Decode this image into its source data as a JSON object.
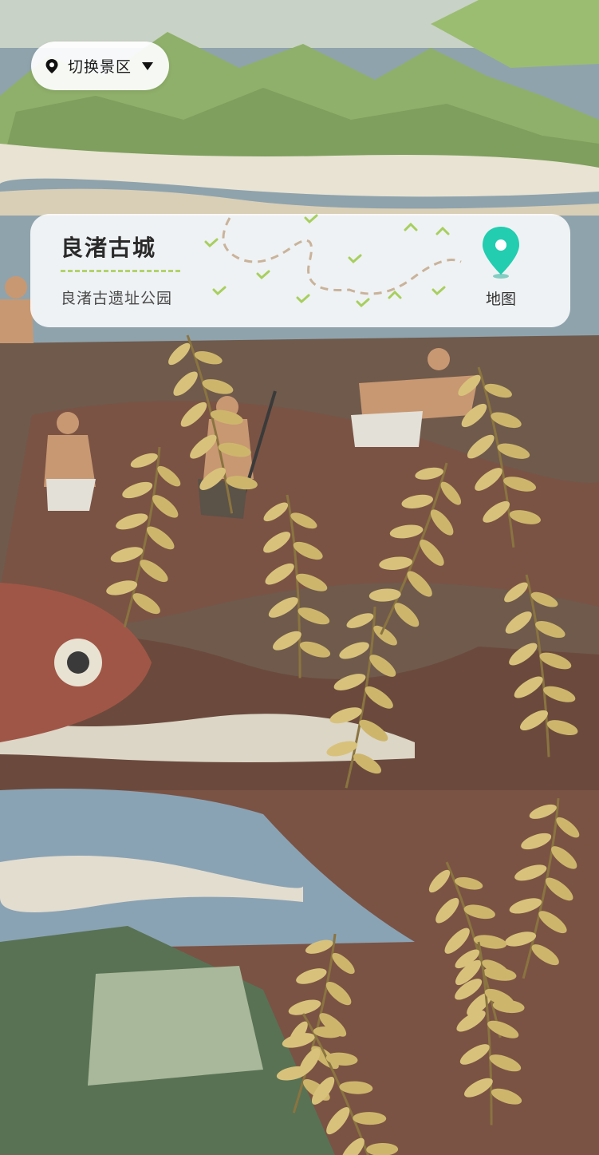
{
  "header": {
    "switch_label": "切换景区",
    "pin_icon": "location-pin-icon",
    "caret_icon": "caret-down-icon"
  },
  "card": {
    "title": "良渚古城",
    "subtitle": "良渚古遗址公园",
    "map_label": "地图",
    "map_icon": "map-pin-icon",
    "accent": "#22cdb0"
  },
  "colors": {
    "water": "#8fa3ad",
    "mountain": "#8fb06a",
    "earth": "#7a5344",
    "fish": "#a05646",
    "grain": "#d8c27b"
  }
}
